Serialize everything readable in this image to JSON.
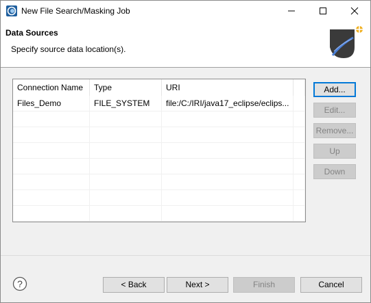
{
  "window": {
    "title": "New File Search/Masking Job",
    "app_icon": "eclipse-app-icon",
    "controls": [
      "minimize-icon",
      "maximize-icon",
      "close-icon"
    ]
  },
  "header": {
    "title": "Data Sources",
    "description": "Specify source data location(s).",
    "image": "wizard-banner-icon"
  },
  "table": {
    "columns": [
      "Connection Name",
      "Type",
      "URI",
      ""
    ],
    "rows": [
      {
        "name": "Files_Demo",
        "type": "FILE_SYSTEM",
        "uri": "file:/C:/IRI/java17_eclipse/eclips..."
      }
    ]
  },
  "side_buttons": {
    "add": "Add...",
    "edit": "Edit...",
    "remove": "Remove...",
    "up": "Up",
    "down": "Down"
  },
  "footer": {
    "help_icon": "help-icon",
    "back": "< Back",
    "next": "Next >",
    "finish": "Finish",
    "cancel": "Cancel"
  },
  "colors": {
    "focus_border": "#0078d7",
    "disabled_text": "#838383"
  }
}
